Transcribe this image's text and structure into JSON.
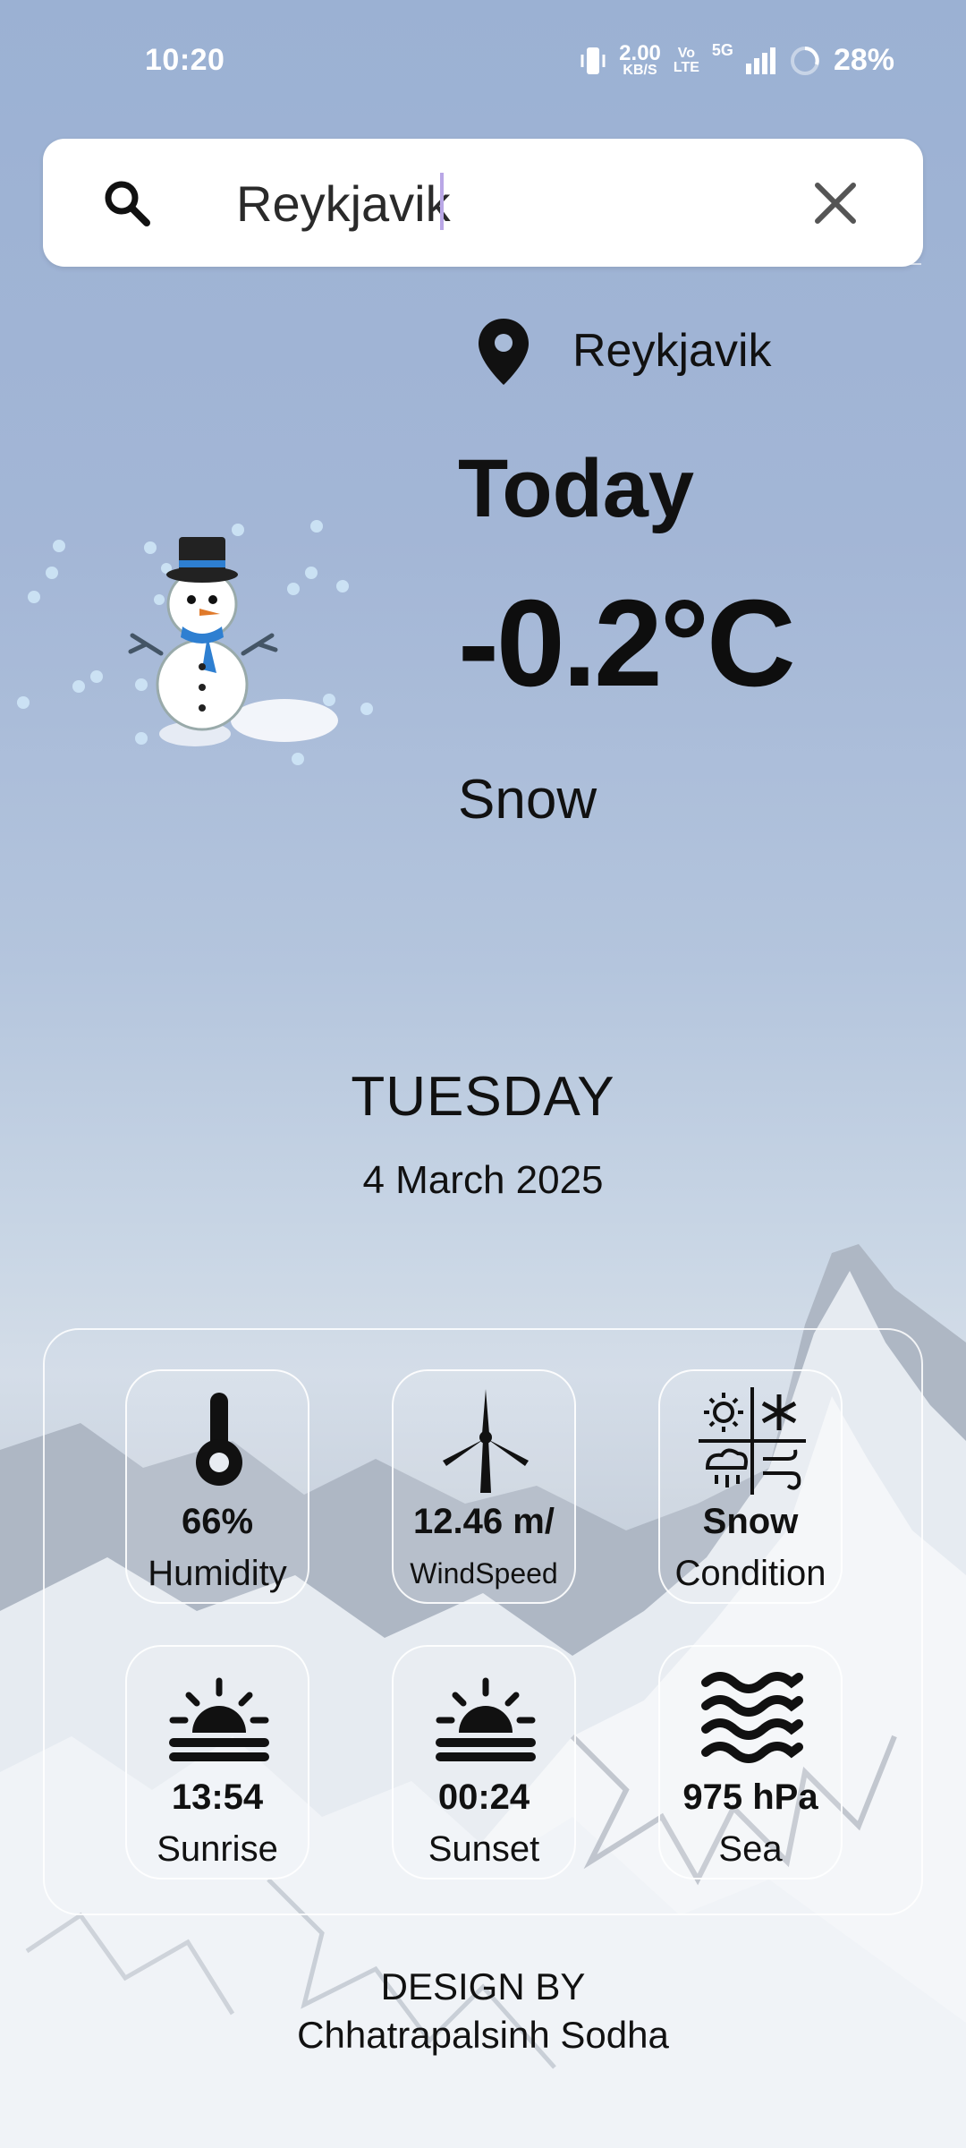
{
  "status": {
    "time": "10:20",
    "net_speed_top": "2.00",
    "net_speed_bottom": "KB/S",
    "volte_top": "Vo",
    "volte_bottom": "LTE",
    "network": "5G",
    "battery": "28%"
  },
  "search": {
    "value": "Reykjavik",
    "placeholder": ""
  },
  "weather": {
    "location": "Reykjavik",
    "heading": "Today",
    "temperature": "-0.2°C",
    "condition": "Snow",
    "day": "TUESDAY",
    "date": "4 March 2025"
  },
  "stats": [
    {
      "icon": "thermometer-icon",
      "value": "66%",
      "label": "Humidity"
    },
    {
      "icon": "wind-turbine-icon",
      "value": "12.46 m/",
      "label": "WindSpeed"
    },
    {
      "icon": "weather-condition-icon",
      "value": "Snow",
      "label": "Condition"
    },
    {
      "icon": "sunrise-icon",
      "value": "13:54",
      "label": "Sunrise"
    },
    {
      "icon": "sunset-icon",
      "value": "00:24",
      "label": "Sunset"
    },
    {
      "icon": "waves-icon",
      "value": "975 hPa",
      "label": "Sea"
    }
  ],
  "footer": {
    "line1": "DESIGN BY",
    "line2": "Chhatrapalsinh Sodha"
  },
  "colors": {
    "text": "#111111",
    "sky_top": "#9bb1d3",
    "caret": "#b9a7e6"
  }
}
